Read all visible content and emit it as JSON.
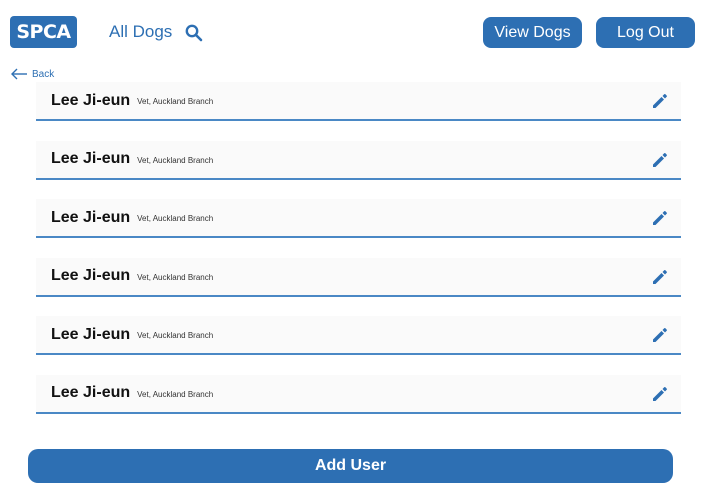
{
  "header": {
    "logo_text": "SPCA",
    "nav_label": "All Dogs",
    "search_icon": "search-icon",
    "view_dogs_label": "View Dogs",
    "log_out_label": "Log Out"
  },
  "back": {
    "label": "Back",
    "icon": "arrow-left-icon"
  },
  "users": [
    {
      "name": "Lee Ji-eun",
      "role": "Vet, Auckland Branch"
    },
    {
      "name": "Lee Ji-eun",
      "role": "Vet, Auckland Branch"
    },
    {
      "name": "Lee Ji-eun",
      "role": "Vet, Auckland Branch"
    },
    {
      "name": "Lee Ji-eun",
      "role": "Vet, Auckland Branch"
    },
    {
      "name": "Lee Ji-eun",
      "role": "Vet, Auckland Branch"
    },
    {
      "name": "Lee Ji-eun",
      "role": "Vet, Auckland Branch"
    }
  ],
  "footer": {
    "add_user_label": "Add User"
  },
  "colors": {
    "accent": "#2d6fb3",
    "row_border": "#4a88c5",
    "row_bg": "#fafafa"
  }
}
